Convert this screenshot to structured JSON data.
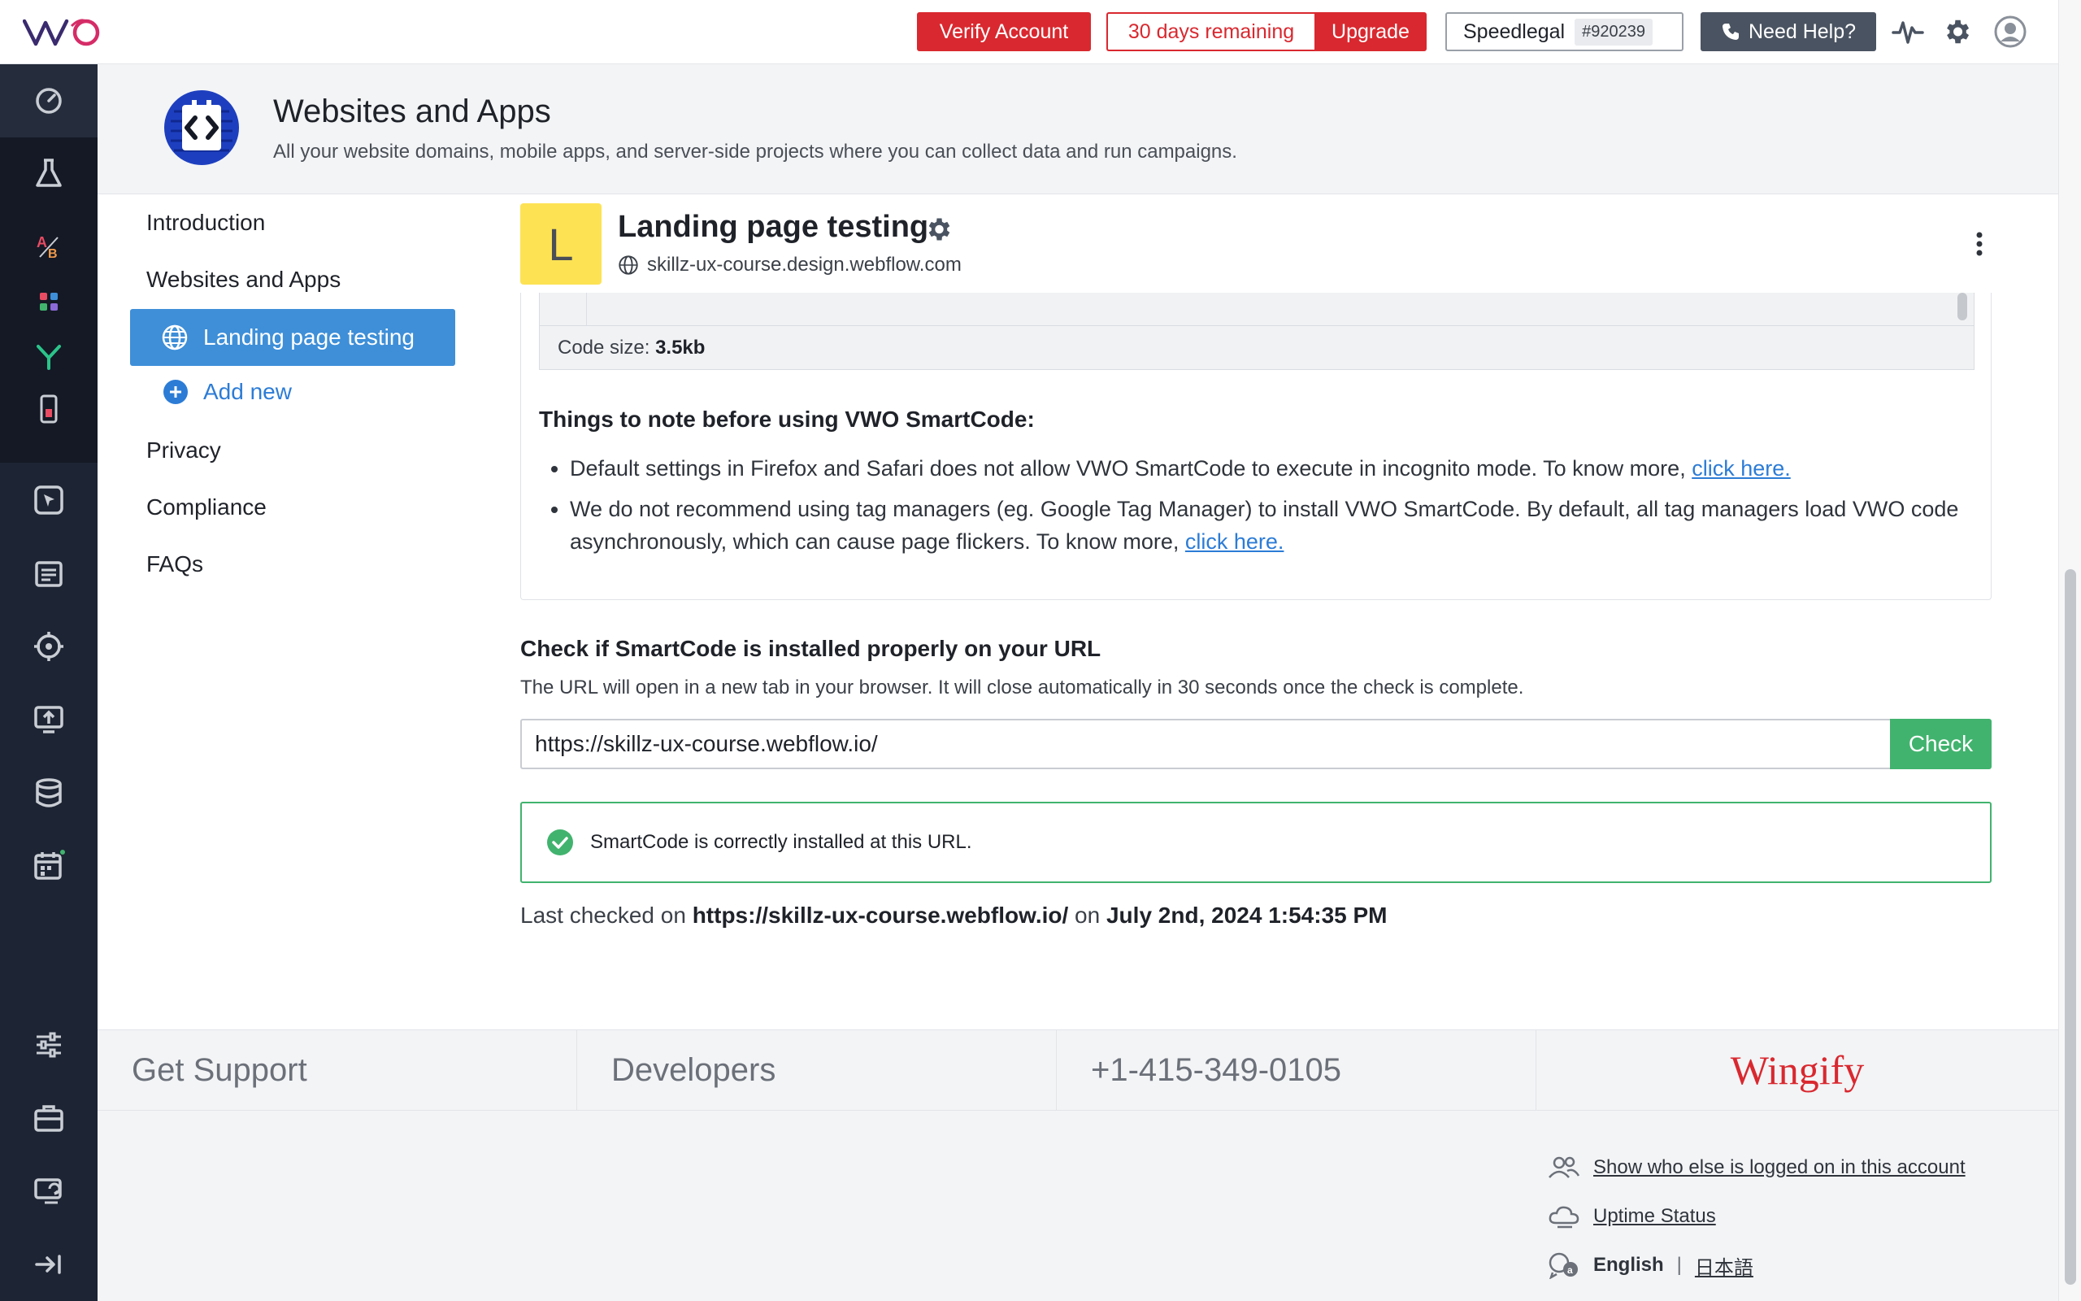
{
  "topbar": {
    "logo_text": "VWO",
    "verify_label": "Verify Account",
    "trial_days_label": "30 days remaining",
    "upgrade_label": "Upgrade",
    "account_name": "Speedlegal",
    "account_id": "#920239",
    "help_label": "Need Help?",
    "icons": [
      "activity-icon",
      "gear-icon",
      "user-avatar-icon"
    ]
  },
  "sidebar": {
    "icons": [
      "dashboard-icon",
      "experiment-flask-icon",
      "ab-test-icon",
      "apps-grid-icon",
      "split-funnel-icon",
      "mobile-icon",
      "heatmap-cursor-icon",
      "survey-list-icon",
      "target-icon",
      "deploy-icon",
      "database-icon",
      "calendar-icon",
      "settings-sliders-icon",
      "briefcase-icon",
      "switch-account-icon",
      "collapse-sidebar-icon"
    ],
    "calendar_badge_color": "#41b36e"
  },
  "header": {
    "title": "Websites and Apps",
    "subtitle": "All your website domains, mobile apps, and server-side projects where you can collect data and run campaigns."
  },
  "leftnav": {
    "items": [
      "Introduction",
      "Websites and Apps",
      "Privacy",
      "Compliance",
      "FAQs"
    ],
    "active_item": "Landing page testing",
    "add_new_label": "Add new"
  },
  "project": {
    "avatar_letter": "L",
    "name": "Landing page testing",
    "domain": "skillz-ux-course.design.webflow.com"
  },
  "smartcode": {
    "code_size_label": "Code size:",
    "code_size_value": "3.5kb",
    "notes_title": "Things to note before using VWO SmartCode:",
    "note_1": "Default settings in Firefox and Safari does not allow VWO SmartCode to execute in incognito mode. To know more,",
    "note_1_link": "click here.",
    "note_2": "We do not recommend using tag managers (eg. Google Tag Manager) to install VWO SmartCode. By default, all tag managers load VWO code asynchronously, which can cause page flickers. To know more,",
    "note_2_link": "click here."
  },
  "check": {
    "title": "Check if SmartCode is installed properly on your URL",
    "description": "The URL will open in a new tab in your browser. It will close automatically in 30 seconds once the check is complete.",
    "url_value": "https://skillz-ux-course.webflow.io/",
    "button_label": "Check",
    "success_message": "SmartCode is correctly installed at this URL.",
    "last_checked_prefix": "Last checked on",
    "last_checked_url": "https://skillz-ux-course.webflow.io/",
    "last_checked_on": "on",
    "last_checked_time": "July 2nd, 2024 1:54:35 PM"
  },
  "footer": {
    "support_label": "Get Support",
    "developers_label": "Developers",
    "phone": "+1-415-349-0105",
    "brand": "Wingify",
    "logged_in_link": "Show who else is logged on in this account",
    "uptime_link": "Uptime Status",
    "lang_english": "English",
    "lang_separator": "|",
    "lang_japanese": "日本語"
  },
  "colors": {
    "brand_red": "#d9282f",
    "primary_blue": "#3e8fd8",
    "success_green": "#41b36e",
    "sidebar_dark": "#1d2433"
  }
}
